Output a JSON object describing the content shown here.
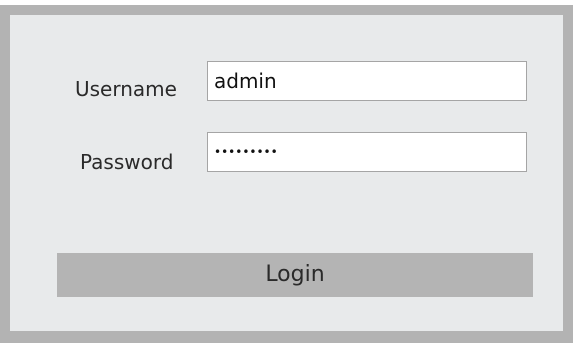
{
  "login_form": {
    "username": {
      "label": "Username",
      "value": "admin"
    },
    "password": {
      "label": "Password",
      "value": "abcdefghi"
    },
    "submit_label": "Login"
  },
  "colors": {
    "frame": "#b3b3b3",
    "panel": "#e8eaeb",
    "input_border": "#a5a5a5",
    "button": "#b4b4b4"
  }
}
